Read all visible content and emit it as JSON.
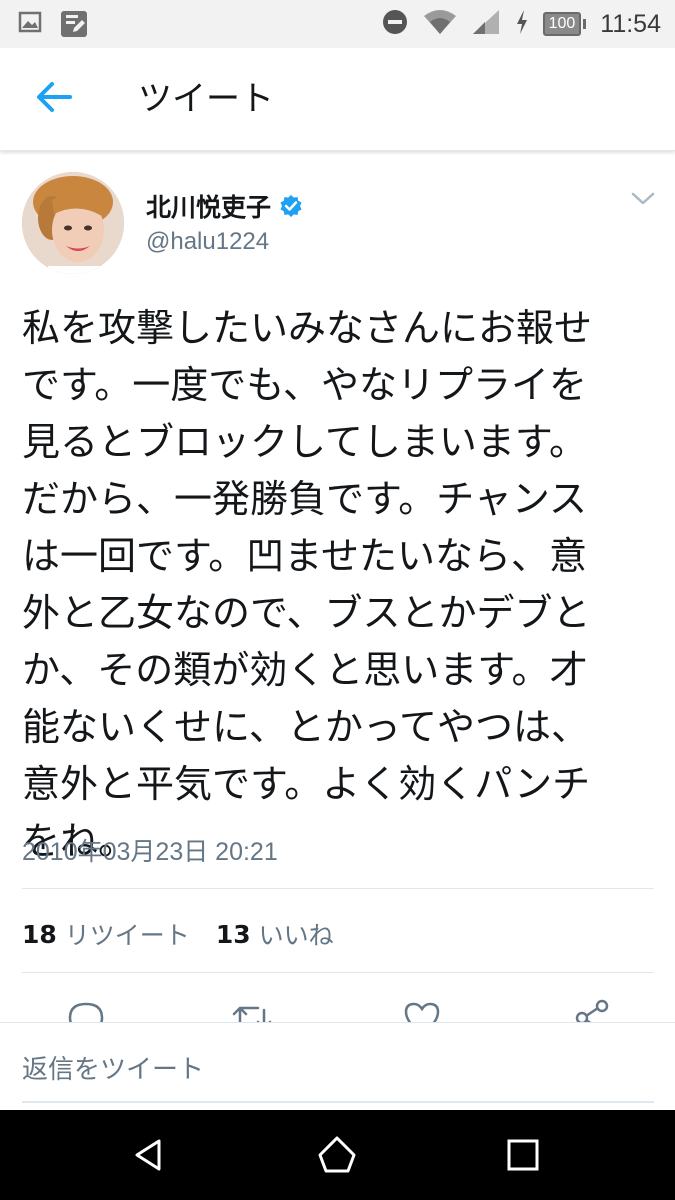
{
  "status_bar": {
    "time": "11:54",
    "battery": "100",
    "icons": [
      "image-icon",
      "edit-icon",
      "do-not-disturb-icon",
      "wifi-icon",
      "signal-icon",
      "charging-icon"
    ]
  },
  "toolbar": {
    "title": "ツイート",
    "back_icon": "back-arrow-icon"
  },
  "tweet": {
    "author_name": "北川悦吏子",
    "handle": "@halu1224",
    "verified": true,
    "text": "私を攻撃したいみなさんにお報せ\nです。一度でも、やなリプライを\n見るとブロックしてしまいます。\nだから、一発勝負です。チャンス\nは一回です。凹ませたいなら、意\n外と乙女なので、ブスとかデブと\nか、その類が効くと思います。才\n能ないくせに、とかってやつは、\n意外と平気です。よく効くパンチ\nをね。",
    "timestamp": "2010年03月23日 20:21",
    "retweet_count": "18",
    "retweet_label": "リツイート",
    "like_count": "13",
    "like_label": "いいね"
  },
  "actions": [
    "reply-icon",
    "retweet-icon",
    "like-icon",
    "share-icon"
  ],
  "reply": {
    "placeholder": "返信をツイート"
  },
  "nav": [
    "nav-back-icon",
    "nav-home-icon",
    "nav-recents-icon"
  ],
  "colors": {
    "accent": "#1da1f2",
    "text": "#14171a",
    "secondary": "#657786"
  }
}
